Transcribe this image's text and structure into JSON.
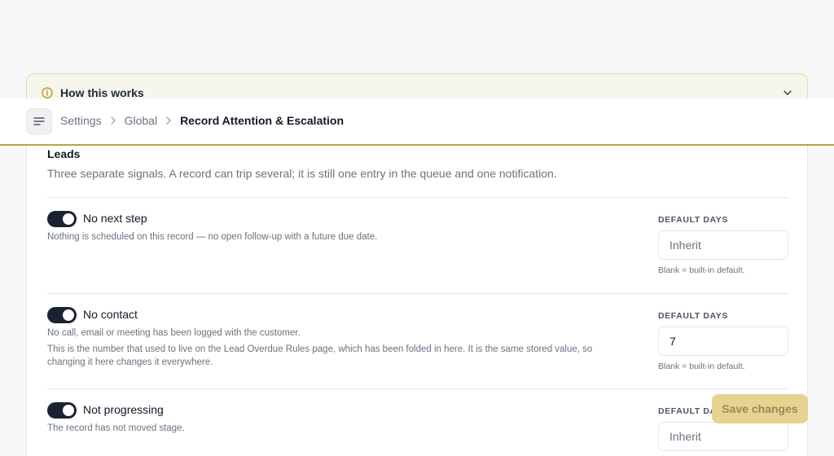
{
  "banner": {
    "title": "How this works"
  },
  "breadcrumb": {
    "items": [
      "Settings",
      "Global"
    ],
    "current": "Record Attention & Escalation"
  },
  "section": {
    "title": "Leads",
    "description": "Three separate signals. A record can trip several; it is still one entry in the queue and one notification."
  },
  "rules": [
    {
      "title": "No next step",
      "enabled": true,
      "description": "Nothing is scheduled on this record — no open follow-up with a future due date.",
      "note": "",
      "field_label": "DEFAULT DAYS",
      "value": "",
      "placeholder": "Inherit",
      "hint": "Blank = built-in default."
    },
    {
      "title": "No contact",
      "enabled": true,
      "description": "No call, email or meeting has been logged with the customer.",
      "note": "This is the number that used to live on the Lead Overdue Rules page, which has been folded in here. It is the same stored value, so changing it here changes it everywhere.",
      "field_label": "DEFAULT DAYS",
      "value": "7",
      "placeholder": "Inherit",
      "hint": "Blank = built-in default."
    },
    {
      "title": "Not progressing",
      "enabled": true,
      "description": "The record has not moved stage.",
      "note": "",
      "field_label": "DEFAULT DAYS",
      "value": "",
      "placeholder": "Inherit",
      "hint": ""
    }
  ],
  "actions": {
    "save_label": "Save changes"
  },
  "colors": {
    "accent": "#b8a344",
    "toggle_on": "#1b2333",
    "save_button": "#e6d38f",
    "banner_bg": "#f7f6ec"
  },
  "icons": {
    "banner": "info-icon",
    "banner_toggle": "chevron-down-icon",
    "menu": "menu-icon",
    "separator": "chevron-right-icon"
  }
}
